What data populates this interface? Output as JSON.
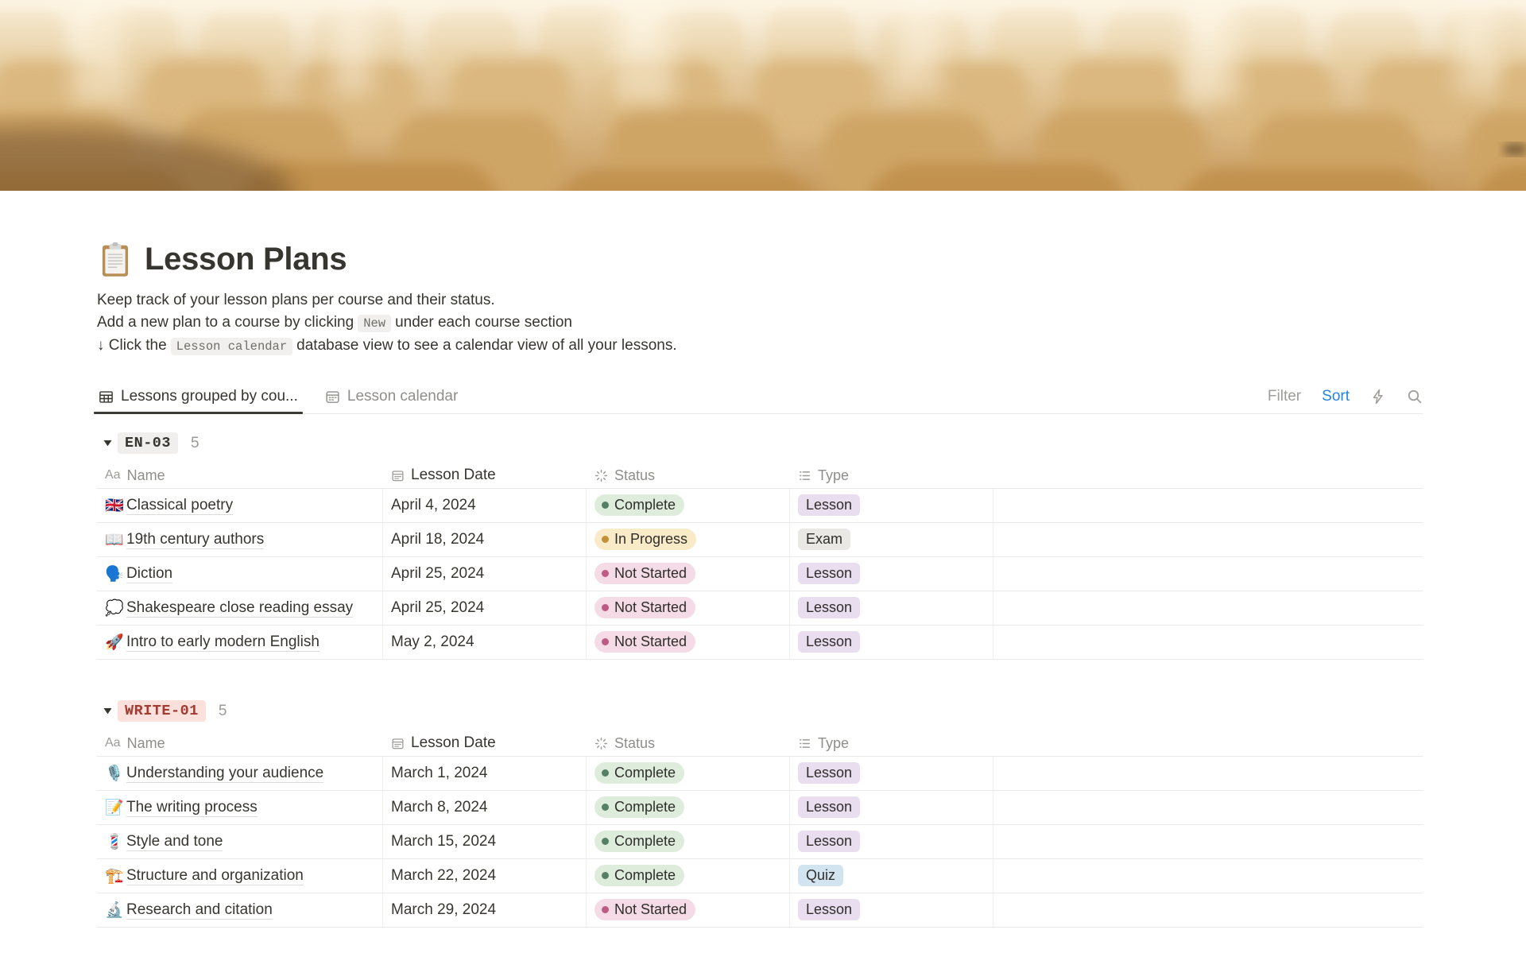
{
  "page": {
    "icon": "📋",
    "title": "Lesson Plans",
    "description": [
      {
        "prefix": "Keep track of your lesson plans per course and their status.",
        "code": "",
        "suffix": ""
      },
      {
        "prefix": "Add a new plan to a course by clicking",
        "code": "New",
        "suffix": "under each course section"
      },
      {
        "prefix": "↓ Click the",
        "code": "Lesson calendar",
        "suffix": "database view to see a calendar view of all your lessons."
      }
    ]
  },
  "toolbar": {
    "tabs": [
      {
        "label": "Lessons grouped by cou...",
        "icon": "table-view-icon",
        "active": true
      },
      {
        "label": "Lesson calendar",
        "icon": "calendar-view-icon",
        "active": false
      }
    ],
    "filter_label": "Filter",
    "sort_label": "Sort",
    "sort_color": "#2383E2"
  },
  "table": {
    "columns": [
      {
        "label": "Name",
        "icon": "text-icon"
      },
      {
        "label": "Lesson Date",
        "icon": "calendar-icon"
      },
      {
        "label": "Status",
        "icon": "status-icon"
      },
      {
        "label": "Type",
        "icon": "list-icon"
      }
    ],
    "status_styles": {
      "Complete": {
        "bg": "#DEECDC",
        "dot": "#548164"
      },
      "In Progress": {
        "bg": "#FAEBC8",
        "dot": "#C19138"
      },
      "Not Started": {
        "bg": "#F5DBE5",
        "dot": "#BE5B85"
      }
    },
    "type_styles": {
      "Lesson": {
        "bg": "#E8DEEF"
      },
      "Exam": {
        "bg": "#E9E8E4"
      },
      "Quiz": {
        "bg": "#D2E4EF"
      }
    },
    "groups": [
      {
        "name": "EN-03",
        "count": "5",
        "badge_bg": "#F0EFED",
        "badge_color": "#37352F",
        "rows": [
          {
            "icon": "🇬🇧",
            "name": "Classical poetry",
            "date": "April 4, 2024",
            "status": "Complete",
            "type": "Lesson"
          },
          {
            "icon": "📖",
            "name": "19th century authors",
            "date": "April 18, 2024",
            "status": "In Progress",
            "type": "Exam"
          },
          {
            "icon": "🗣️",
            "name": "Diction",
            "date": "April 25, 2024",
            "status": "Not Started",
            "type": "Lesson"
          },
          {
            "icon": "💭",
            "name": "Shakespeare close reading essay",
            "date": "April 25, 2024",
            "status": "Not Started",
            "type": "Lesson"
          },
          {
            "icon": "🚀",
            "name": "Intro to early modern English",
            "date": "May 2, 2024",
            "status": "Not Started",
            "type": "Lesson"
          }
        ]
      },
      {
        "name": "WRITE-01",
        "count": "5",
        "badge_bg": "#FBE0DB",
        "badge_color": "#A23C32",
        "rows": [
          {
            "icon": "🎙️",
            "name": "Understanding your audience",
            "date": "March 1, 2024",
            "status": "Complete",
            "type": "Lesson"
          },
          {
            "icon": "📝",
            "name": "The writing process",
            "date": "March 8, 2024",
            "status": "Complete",
            "type": "Lesson"
          },
          {
            "icon": "💈",
            "name": "Style and tone",
            "date": "March 15, 2024",
            "status": "Complete",
            "type": "Lesson"
          },
          {
            "icon": "🏗️",
            "name": "Structure and organization",
            "date": "March 22, 2024",
            "status": "Complete",
            "type": "Quiz"
          },
          {
            "icon": "🔬",
            "name": "Research and citation",
            "date": "March 29, 2024",
            "status": "Not Started",
            "type": "Lesson"
          }
        ]
      }
    ]
  }
}
